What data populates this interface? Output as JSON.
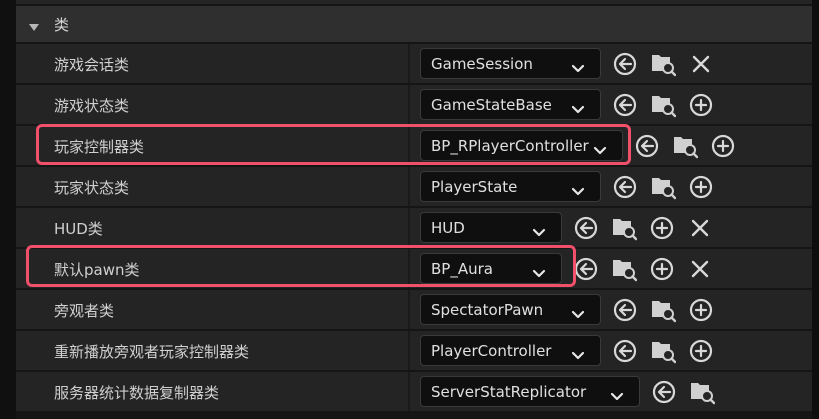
{
  "section": {
    "title": "类"
  },
  "rows": [
    {
      "label": "游戏会话类",
      "value": "GameSession"
    },
    {
      "label": "游戏状态类",
      "value": "GameStateBase"
    },
    {
      "label": "玩家控制器类",
      "value": "BP_RPlayerController"
    },
    {
      "label": "玩家状态类",
      "value": "PlayerState"
    },
    {
      "label": "HUD类",
      "value": "HUD"
    },
    {
      "label": "默认pawn类",
      "value": "BP_Aura"
    },
    {
      "label": "旁观者类",
      "value": "SpectatorPawn"
    },
    {
      "label": "重新播放旁观者玩家控制器类",
      "value": "PlayerController"
    },
    {
      "label": "服务器统计数据复制器类",
      "value": "ServerStatReplicator"
    }
  ],
  "icons": {
    "use": "use-selected-icon",
    "browse": "browse-asset-icon",
    "add": "add-new-icon",
    "clear": "clear-icon",
    "collapse": "chevron-down-icon"
  },
  "colors": {
    "highlight": "#f0506a",
    "row_bg": "#242424",
    "header_bg": "#2f2f2f",
    "combo_bg": "#0f0f0f"
  }
}
